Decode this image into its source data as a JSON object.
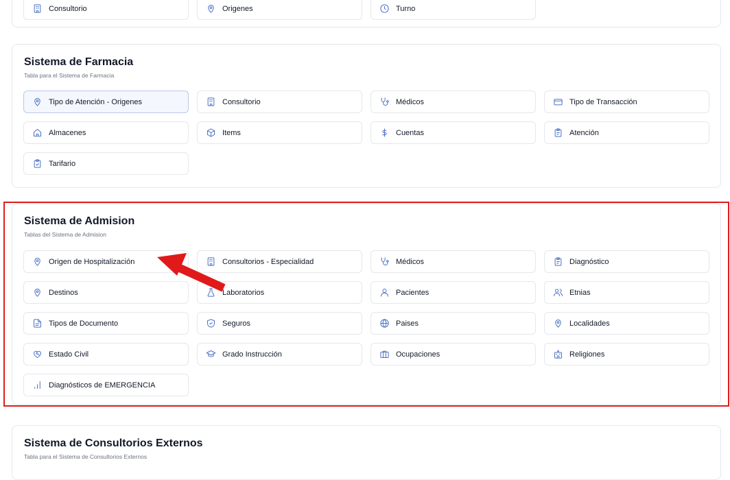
{
  "top_card": {
    "items": [
      {
        "label": "Consultorio",
        "icon": "building-icon"
      },
      {
        "label": "Origenes",
        "icon": "pin-icon"
      },
      {
        "label": "Turno",
        "icon": "clock-icon"
      }
    ]
  },
  "farmacia": {
    "title": "Sistema de Farmacia",
    "subtitle": "Tabla para el Sistema de Farmacia",
    "items": [
      {
        "label": "Tipo de Atención - Origenes",
        "icon": "pin-icon"
      },
      {
        "label": "Consultorio",
        "icon": "building-icon"
      },
      {
        "label": "Médicos",
        "icon": "stethoscope-icon"
      },
      {
        "label": "Tipo de Transacción",
        "icon": "card-icon"
      },
      {
        "label": "Almacenes",
        "icon": "home-icon"
      },
      {
        "label": "Items",
        "icon": "box-icon"
      },
      {
        "label": "Cuentas",
        "icon": "dollar-icon"
      },
      {
        "label": "Atención",
        "icon": "clipboard-icon"
      },
      {
        "label": "Tarifario",
        "icon": "clipboard-check-icon"
      }
    ]
  },
  "admision": {
    "title": "Sistema de Admision",
    "subtitle": "Tablas del Sistema de Admision",
    "items": [
      {
        "label": "Origen de Hospitalización",
        "icon": "pin-icon"
      },
      {
        "label": "Consultorios - Especialidad",
        "icon": "building-icon"
      },
      {
        "label": "Médicos",
        "icon": "stethoscope-icon"
      },
      {
        "label": "Diagnóstico",
        "icon": "clipboard-icon"
      },
      {
        "label": "Destinos",
        "icon": "pin-icon"
      },
      {
        "label": "Laboratorios",
        "icon": "flask-icon"
      },
      {
        "label": "Pacientes",
        "icon": "user-icon"
      },
      {
        "label": "Etnias",
        "icon": "users-icon"
      },
      {
        "label": "Tipos de Documento",
        "icon": "file-icon"
      },
      {
        "label": "Seguros",
        "icon": "shield-icon"
      },
      {
        "label": "Paises",
        "icon": "globe-icon"
      },
      {
        "label": "Localidades",
        "icon": "pin-icon"
      },
      {
        "label": "Estado Civil",
        "icon": "heart-handshake-icon"
      },
      {
        "label": "Grado Instrucción",
        "icon": "graduation-cap-icon"
      },
      {
        "label": "Ocupaciones",
        "icon": "briefcase-icon"
      },
      {
        "label": "Religiones",
        "icon": "church-icon"
      },
      {
        "label": "Diagnósticos de EMERGENCIA",
        "icon": "bar-chart-icon"
      }
    ]
  },
  "externos": {
    "title": "Sistema de Consultorios Externos",
    "subtitle": "Tabla para el Sistema de Consultorios Externos"
  },
  "colors": {
    "accent": "#4a71c4",
    "highlight": "#e01a1a",
    "border": "#e5e7eb",
    "subtitle": "#6b7280"
  }
}
